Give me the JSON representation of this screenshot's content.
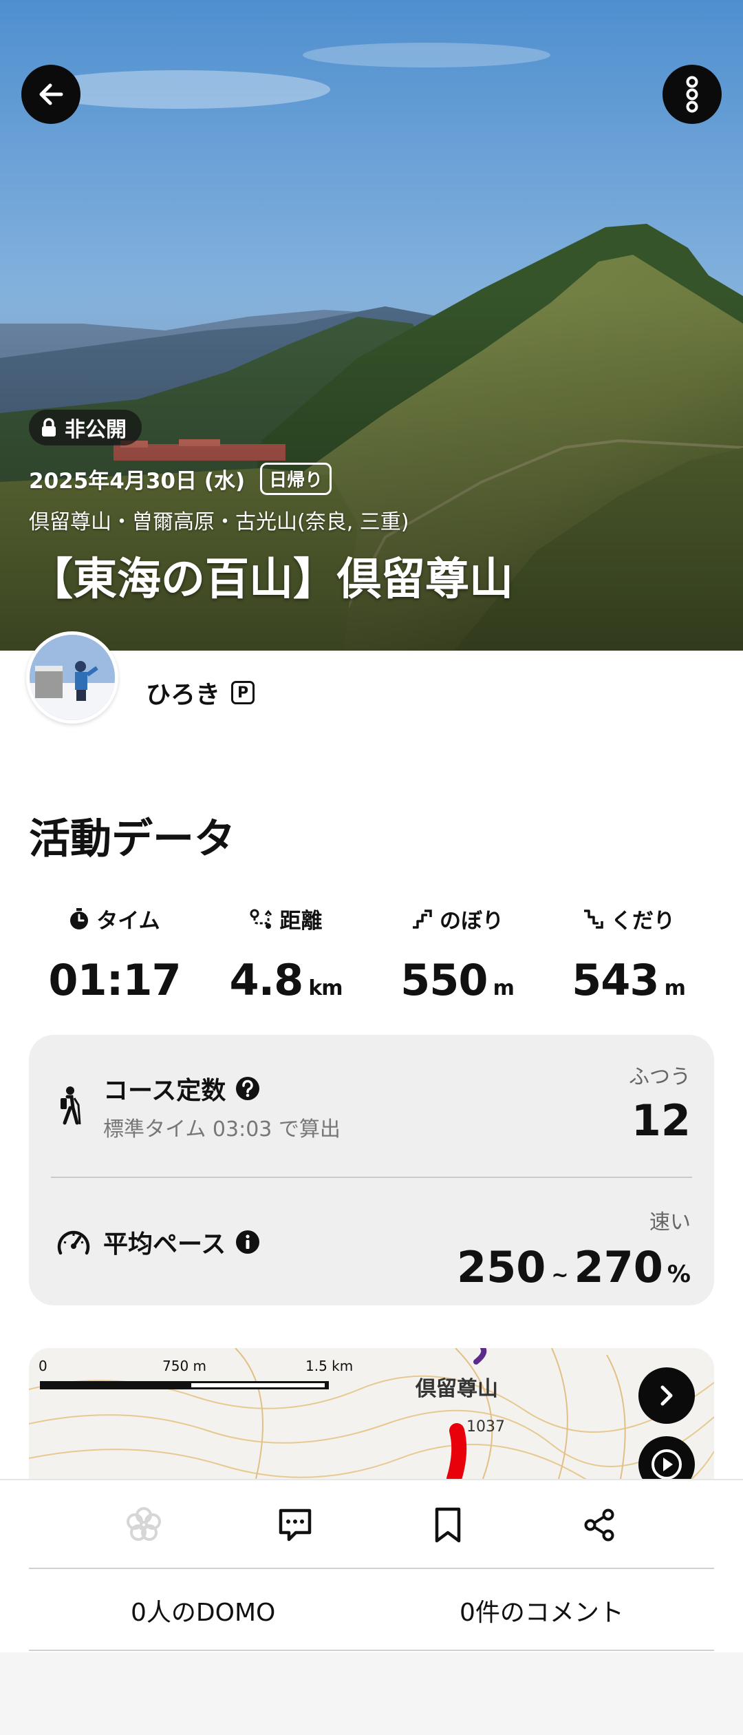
{
  "hero": {
    "private_label": "非公開",
    "date": "2025年4月30日 (水)",
    "trip_type": "日帰り",
    "area": "倶留尊山・曽爾高原・古光山(奈良, 三重)",
    "title": "【東海の百山】倶留尊山"
  },
  "user": {
    "name": "ひろき",
    "badge": "P"
  },
  "activity": {
    "section_title": "活動データ",
    "stats": [
      {
        "label": "タイム",
        "value": "01:17",
        "unit": "",
        "icon": "stopwatch-icon"
      },
      {
        "label": "距離",
        "value": "4.8",
        "unit": "km",
        "icon": "route-icon"
      },
      {
        "label": "のぼり",
        "value": "550",
        "unit": "m",
        "icon": "ascent-icon"
      },
      {
        "label": "くだり",
        "value": "543",
        "unit": "m",
        "icon": "descent-icon"
      }
    ],
    "course": {
      "title": "コース定数",
      "subtitle": "標準タイム 03:03 で算出",
      "level": "ふつう",
      "value": "12"
    },
    "pace": {
      "title": "平均ペース",
      "level": "速い",
      "min": "250",
      "tilde": "~",
      "max": "270",
      "unit": "%"
    }
  },
  "map": {
    "scale_0": "0",
    "scale_mid": "750 m",
    "scale_max": "1.5 km",
    "peak_label": "倶留尊山",
    "elevation_label": "1037"
  },
  "bottom": {
    "domo_count": "0人のDOMO",
    "comment_count": "0件のコメント"
  },
  "colors": {
    "track": "#e8000b",
    "card_bg": "#efefef",
    "button_dark": "#0b0b0b"
  }
}
